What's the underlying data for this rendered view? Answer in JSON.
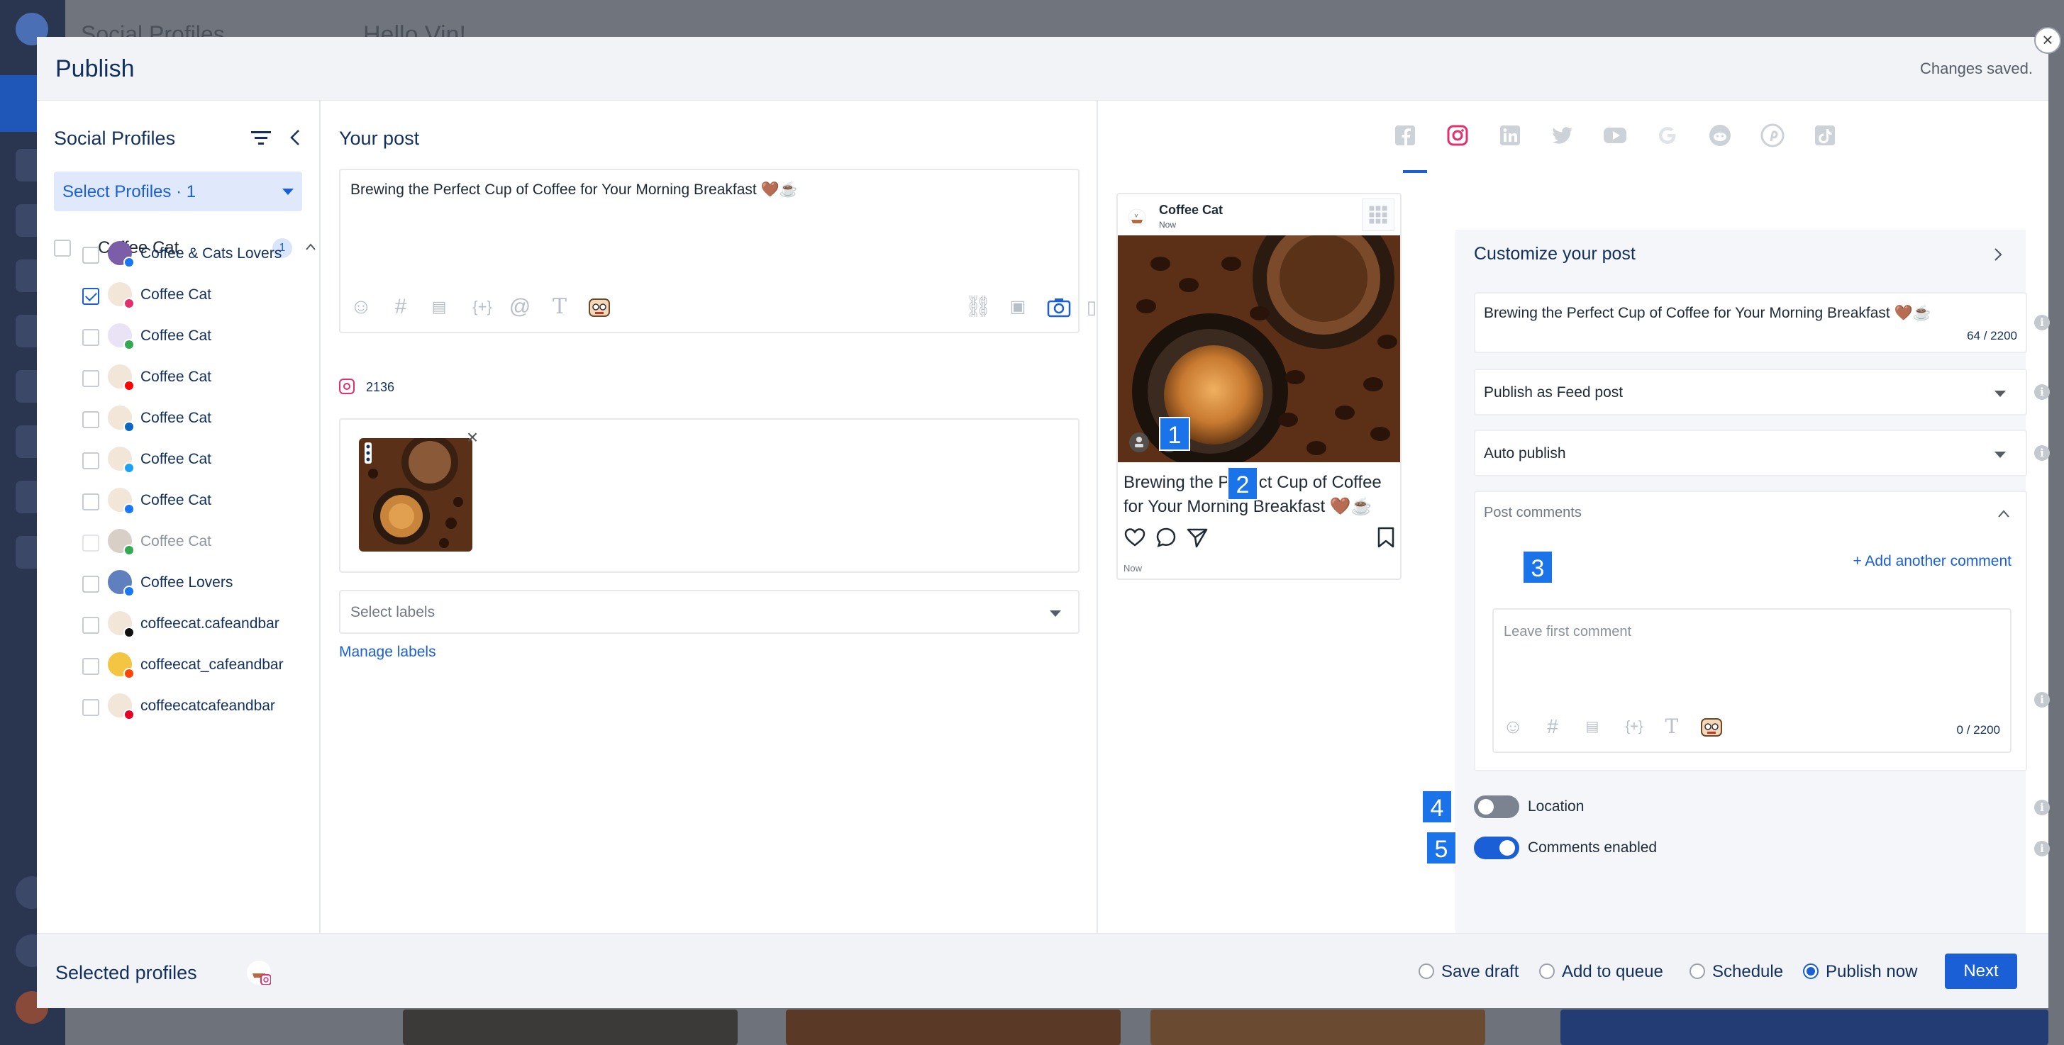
{
  "background": {
    "header_title": "Social Profiles",
    "header_greeting": "Hello Vin!"
  },
  "modal": {
    "title": "Publish",
    "status": "Changes saved.",
    "close_label": "×"
  },
  "profiles_panel": {
    "title": "Social Profiles",
    "select_label": "Select Profiles · 1",
    "group": {
      "name": "Coffee Cat",
      "count": "1"
    },
    "items": [
      {
        "name": "Coffee & Cats Lovers",
        "network": "facebook",
        "checked": false
      },
      {
        "name": "Coffee Cat",
        "network": "instagram",
        "checked": true
      },
      {
        "name": "Coffee Cat",
        "network": "google",
        "checked": false
      },
      {
        "name": "Coffee Cat",
        "network": "youtube",
        "checked": false
      },
      {
        "name": "Coffee Cat",
        "network": "linkedin",
        "checked": false
      },
      {
        "name": "Coffee Cat",
        "network": "twitter",
        "checked": false
      },
      {
        "name": "Coffee Cat",
        "network": "facebook",
        "checked": false
      },
      {
        "name": "Coffee Cat",
        "network": "google",
        "checked": false,
        "disabled": true
      },
      {
        "name": "Coffee Lovers",
        "network": "facebook",
        "checked": false
      },
      {
        "name": "coffeecat.cafeandbar",
        "network": "tiktok",
        "checked": false
      },
      {
        "name": "coffeecat_cafeandbar",
        "network": "reddit",
        "checked": false
      },
      {
        "name": "coffeecatcafeandbar",
        "network": "pinterest",
        "checked": false
      }
    ]
  },
  "post_panel": {
    "title": "Your post",
    "post_text": "Brewing the Perfect Cup of Coffee for Your Morning Breakfast 🤎☕",
    "char_count": "2136",
    "labels_placeholder": "Select labels",
    "manage_labels": "Manage labels"
  },
  "preview": {
    "account_name": "Coffee Cat",
    "time_top": "Now",
    "caption": "Brewing the Perfect Cup of Coffee for Your Morning Breakfast 🤎☕",
    "time_bottom": "Now"
  },
  "network_tabs": [
    "facebook",
    "instagram",
    "linkedin",
    "twitter",
    "youtube",
    "google",
    "reddit",
    "pinterest",
    "tiktok"
  ],
  "active_network": "instagram",
  "badges": [
    "1",
    "2",
    "3",
    "4",
    "5"
  ],
  "customize": {
    "title": "Customize your post",
    "text": "Brewing the Perfect Cup of Coffee for Your Morning Breakfast 🤎☕",
    "text_count": "64 / 2200",
    "publish_as": "Publish as Feed post",
    "publish_mode": "Auto publish",
    "post_comments_title": "Post comments",
    "add_comment": "+ Add another comment",
    "comment_placeholder": "Leave first comment",
    "comment_count": "0 / 2200",
    "location_label": "Location",
    "location_enabled": false,
    "comments_label": "Comments enabled",
    "comments_enabled": true
  },
  "footer": {
    "title": "Selected profiles",
    "options": [
      {
        "label": "Save draft",
        "selected": false
      },
      {
        "label": "Add to queue",
        "selected": false
      },
      {
        "label": "Schedule",
        "selected": false
      },
      {
        "label": "Publish now",
        "selected": true
      }
    ],
    "next_label": "Next"
  },
  "colors": {
    "accent": "#1a5fd6",
    "title": "#12305e",
    "instagram": "#e1306c",
    "badge": "#1a73e8"
  }
}
